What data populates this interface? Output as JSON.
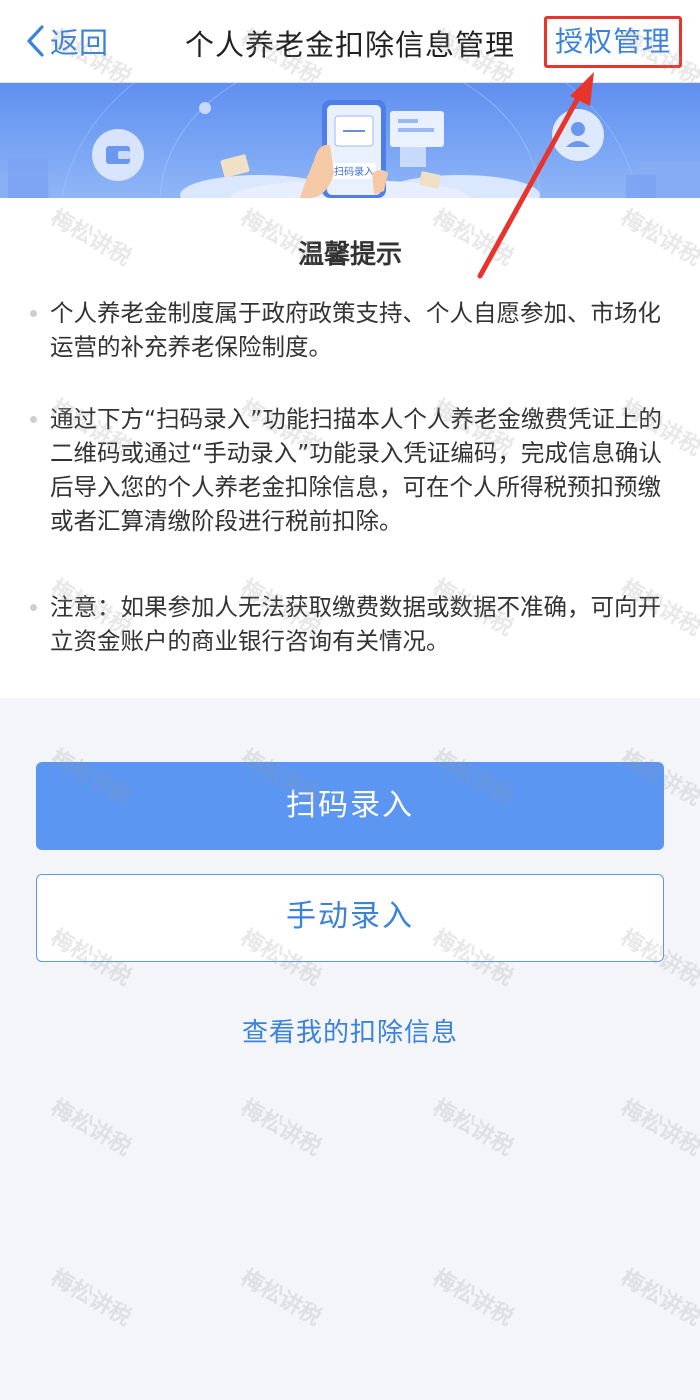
{
  "navbar": {
    "back_label": "返回",
    "title": "个人养老金扣除信息管理",
    "auth_label": "授权管理"
  },
  "banner": {
    "phone_button_label": "扫码录入"
  },
  "tips": {
    "title": "温馨提示",
    "items": [
      "个人养老金制度属于政府政策支持、个人自愿参加、市场化运营的补充养老保险制度。",
      "通过下方“扫码录入”功能扫描本人个人养老金缴费凭证上的二维码或通过“手动录入”功能录入凭证编码，完成信息确认后导入您的个人养老金扣除信息，可在个人所得税预扣预缴或者汇算清缴阶段进行税前扣除。",
      "注意：如果参加人无法获取缴费数据或数据不准确，可向开立资金账户的商业银行咨询有关情况。"
    ]
  },
  "actions": {
    "scan_label": "扫码录入",
    "manual_label": "手动录入",
    "view_label": "查看我的扣除信息"
  },
  "watermark": {
    "text": "梅松讲税"
  },
  "colors": {
    "accent": "#3b82d9",
    "primary_button": "#5b97f2",
    "annotation_red": "#e9342c"
  }
}
